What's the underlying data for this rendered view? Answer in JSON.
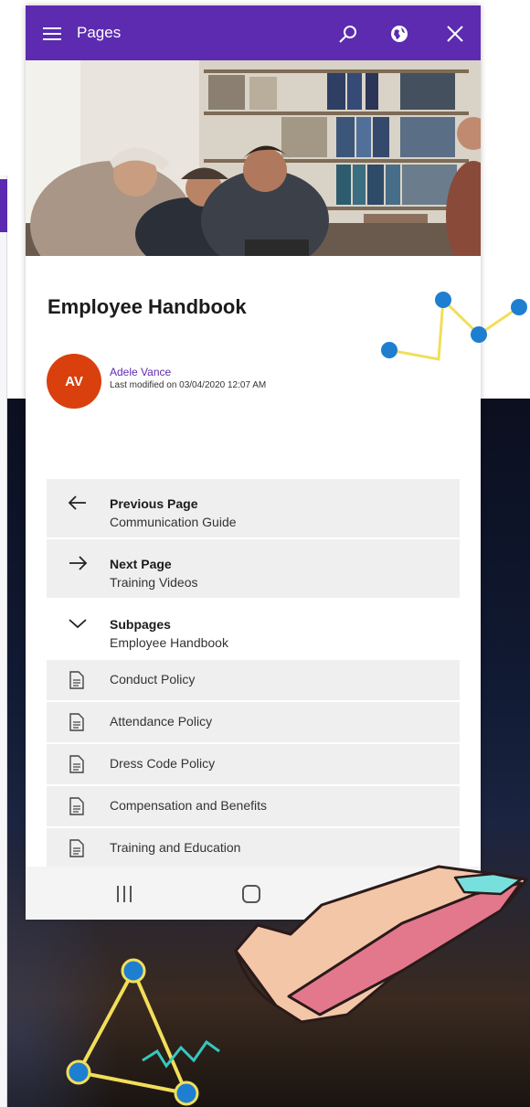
{
  "appbar": {
    "title": "Pages",
    "icons": [
      "hamburger-menu-icon",
      "search-icon",
      "globe-icon",
      "close-icon"
    ]
  },
  "page": {
    "title": "Employee Handbook",
    "author": {
      "initials": "AV",
      "name": "Adele Vance",
      "modified": "Last modified on 03/04/2020 12:07 AM",
      "avatar_color": "#d9400e"
    }
  },
  "navigation": {
    "previous": {
      "label": "Previous Page",
      "page": "Communication Guide",
      "icon": "arrow-left-icon"
    },
    "next": {
      "label": "Next Page",
      "page": "Training Videos",
      "icon": "arrow-right-icon"
    },
    "subpages": {
      "label": "Subpages",
      "page": "Employee Handbook",
      "icon": "chevron-down-icon"
    }
  },
  "subpages": [
    {
      "label": "Conduct Policy"
    },
    {
      "label": "Attendance Policy"
    },
    {
      "label": "Dress Code Policy"
    },
    {
      "label": "Compensation and Benefits"
    },
    {
      "label": "Training and Education"
    }
  ],
  "system_nav": [
    "recent-apps-icon",
    "home-icon",
    "back-icon"
  ],
  "colors": {
    "appbar": "#5c2bb0",
    "accent": "#5c2bb0",
    "row_bg": "#efefef"
  }
}
